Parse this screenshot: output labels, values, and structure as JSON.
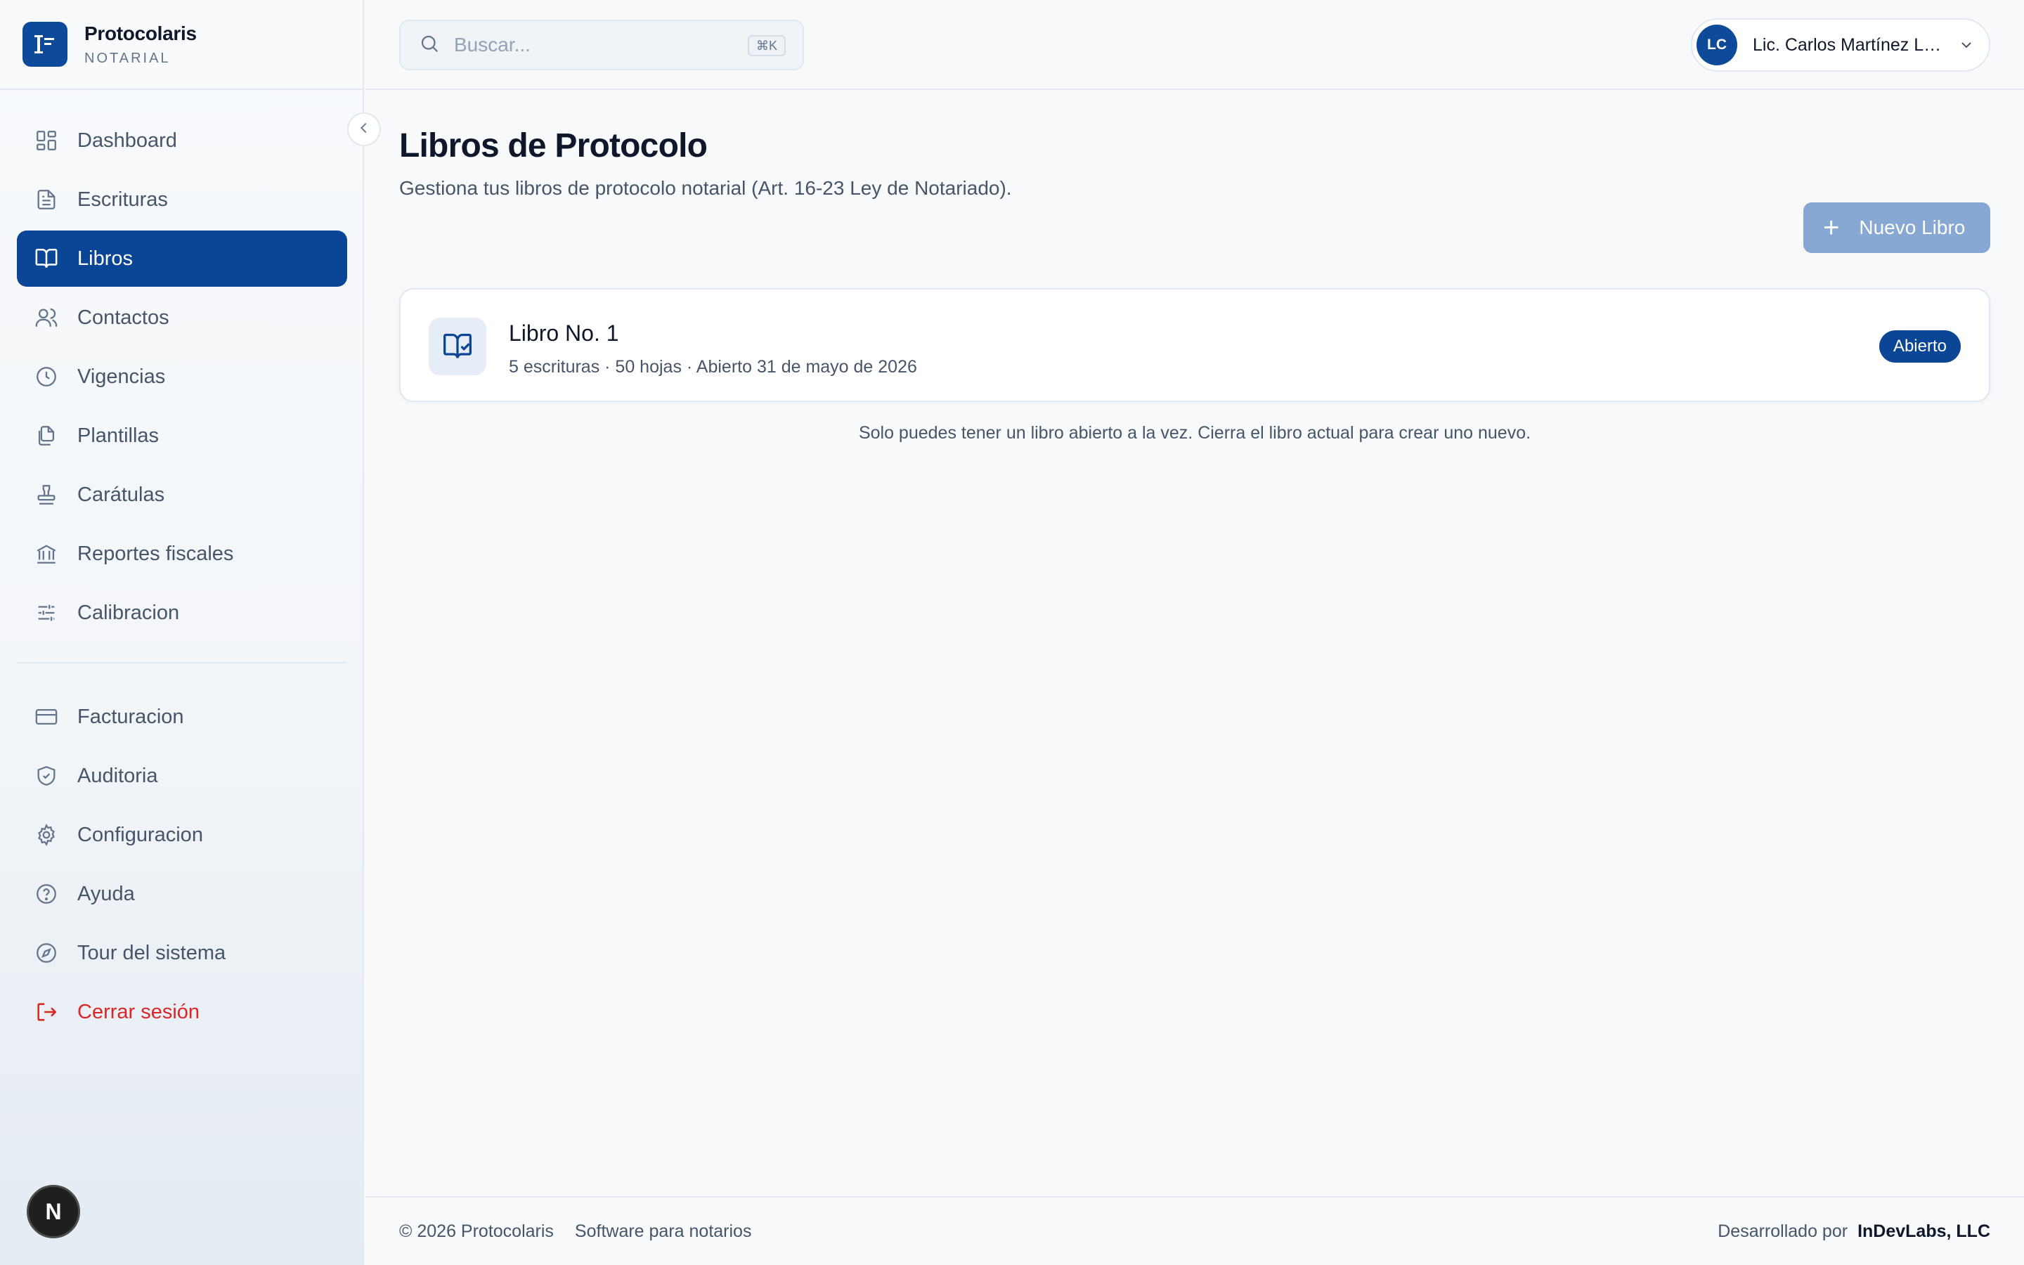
{
  "brand": {
    "name": "Protocolaris",
    "subtitle": "NOTARIAL"
  },
  "topbar": {
    "search_placeholder": "Buscar...",
    "search_shortcut": "⌘K",
    "user": {
      "initials": "LC",
      "name": "Lic. Carlos Martínez López"
    }
  },
  "sidebar": {
    "items": [
      {
        "label": "Dashboard",
        "icon": "dashboard-icon"
      },
      {
        "label": "Escrituras",
        "icon": "document-icon"
      },
      {
        "label": "Libros",
        "icon": "book-icon",
        "active": true
      },
      {
        "label": "Contactos",
        "icon": "users-icon"
      },
      {
        "label": "Vigencias",
        "icon": "clock-icon"
      },
      {
        "label": "Plantillas",
        "icon": "copy-icon"
      },
      {
        "label": "Carátulas",
        "icon": "stamp-icon"
      },
      {
        "label": "Reportes fiscales",
        "icon": "bank-icon"
      },
      {
        "label": "Calibracion",
        "icon": "sliders-icon"
      }
    ],
    "secondary": [
      {
        "label": "Facturacion",
        "icon": "credit-card-icon"
      },
      {
        "label": "Auditoria",
        "icon": "shield-icon"
      },
      {
        "label": "Configuracion",
        "icon": "gear-icon"
      },
      {
        "label": "Ayuda",
        "icon": "help-icon"
      },
      {
        "label": "Tour del sistema",
        "icon": "compass-icon"
      },
      {
        "label": "Cerrar sesión",
        "icon": "logout-icon"
      }
    ],
    "bottom_badge": "N"
  },
  "main": {
    "title": "Libros de Protocolo",
    "subtitle": "Gestiona tus libros de protocolo notarial (Art. 16-23 Ley de Notariado).",
    "new_button": "Nuevo Libro",
    "books": [
      {
        "title": "Libro No. 1",
        "meta": "5 escrituras · 50 hojas · Abierto 31 de mayo de 2026",
        "status": "Abierto"
      }
    ],
    "notice": "Solo puedes tener un libro abierto a la vez. Cierra el libro actual para crear uno nuevo."
  },
  "footer": {
    "copyright": "© 2026 Protocolaris",
    "tagline": "Software para notarios",
    "developed_by": "Desarrollado por",
    "developer": "InDevLabs, LLC"
  },
  "colors": {
    "primary": "#0b4595",
    "button_disabled": "#86a8d2",
    "logout": "#dc2626",
    "background": "#f7f9fb"
  }
}
